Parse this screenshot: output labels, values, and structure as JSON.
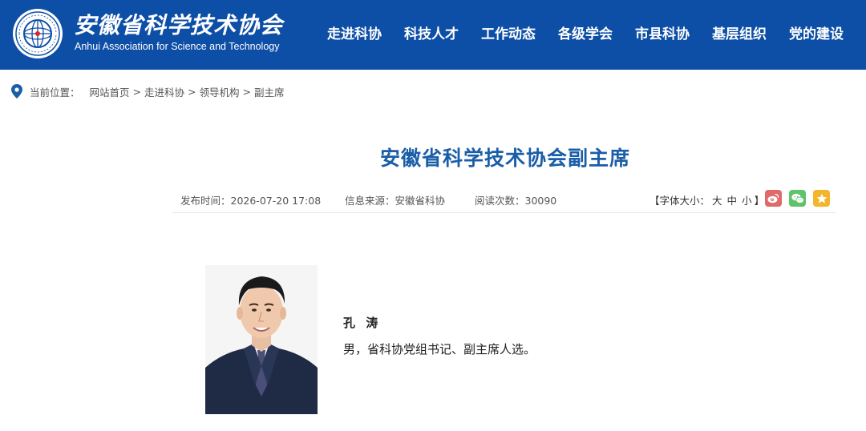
{
  "header": {
    "logo_cn": "安徽省科学技术协会",
    "logo_en": "Anhui Association for Science and Technology",
    "nav": [
      "走进科协",
      "科技人才",
      "工作动态",
      "各级学会",
      "市县科协",
      "基层组织",
      "党的建设"
    ],
    "colors": {
      "bar": "#0d4ea6",
      "text": "#ffffff"
    }
  },
  "breadcrumb": {
    "label": "当前位置：",
    "items": [
      "网站首页",
      "走进科协",
      "领导机构",
      "副主席"
    ],
    "separator": ">"
  },
  "article": {
    "title": "安徽省科学技术协会副主席",
    "publish_time": "发布时间：2026-07-20 17:08",
    "source": "信息来源：安徽省科协",
    "views": "阅读次数：30090",
    "font_size": {
      "prefix": "【字体大小：",
      "large": "大",
      "medium": "中",
      "small": "小",
      "suffix": "】"
    },
    "share_icons": [
      "weibo-icon",
      "wechat-icon",
      "star-icon"
    ],
    "title_color": "#1a5ea8"
  },
  "person": {
    "name": "孔 涛",
    "description": "男，省科协党组书记、副主席人选。"
  }
}
